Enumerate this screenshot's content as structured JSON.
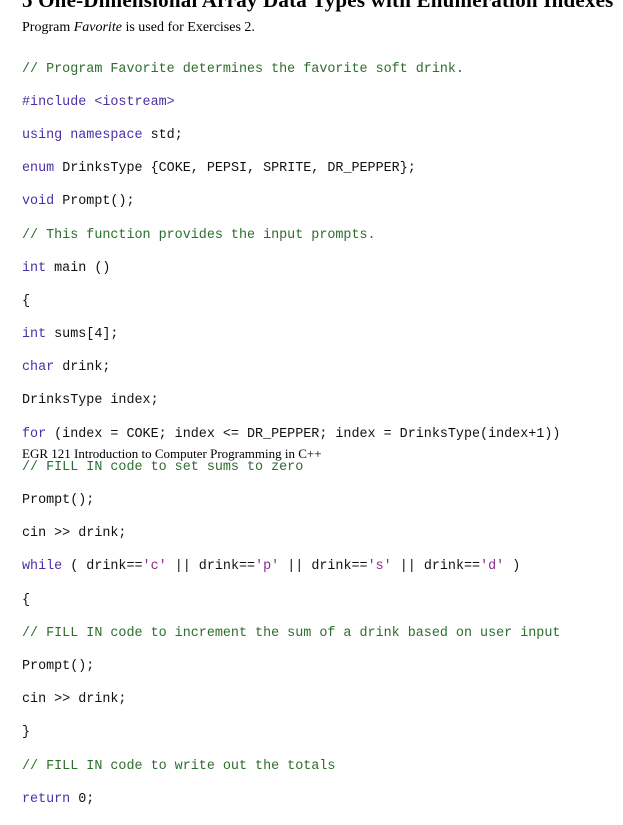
{
  "heading": "5 One-Dimensional Array Data Types with Enumeration Indexes",
  "intro": {
    "prefix": "Program ",
    "program_name": "Favorite",
    "suffix": " is used for Exercises 2."
  },
  "code": {
    "l01": "// Program Favorite determines the favorite soft drink.",
    "l02": "#include <iostream>",
    "l03_kw": "using namespace",
    "l03_rest": " std;",
    "l04_kw": "enum",
    "l04_rest": " DrinksType {COKE, PEPSI, SPRITE, DR_PEPPER};",
    "l05_kw": "void",
    "l05_rest": " Prompt();",
    "l06": "// This function provides the input prompts.",
    "l07_kw": "int",
    "l07_rest": " main ()",
    "l08": "{",
    "l09_kw": "int",
    "l09_rest": " sums[4];",
    "l10_kw": "char",
    "l10_rest": " drink;",
    "l11": "DrinksType index;",
    "l12_kw": "for",
    "l12_rest": " (index = COKE; index <= DR_PEPPER; index = DrinksType(index+1))",
    "l13": "// FILL IN code to set sums to zero",
    "l14": "Prompt();",
    "l15": "cin >> drink;",
    "l16_kw": "while",
    "l16_rest_a": " ( drink==",
    "l16_s1": "'c'",
    "l16_rest_b": " || drink==",
    "l16_s2": "'p'",
    "l16_rest_c": " || drink==",
    "l16_s3": "'s'",
    "l16_rest_d": " || drink==",
    "l16_s4": "'d'",
    "l16_rest_e": " )",
    "l17": "{",
    "l18": "// FILL IN code to increment the sum of a drink based on user input",
    "l19": "Prompt();",
    "l20": "cin >> drink;",
    "l21": "}",
    "l22": "// FILL IN code to write out the totals",
    "l23_kw": "return",
    "l23_rest": " 0;"
  },
  "footer": "EGR 121 Introduction to Computer Programming in C++",
  "colors": {
    "comment": "#2c6e2c",
    "keyword": "#4b2fa8",
    "string": "#8a2b8a",
    "text": "#111111"
  }
}
